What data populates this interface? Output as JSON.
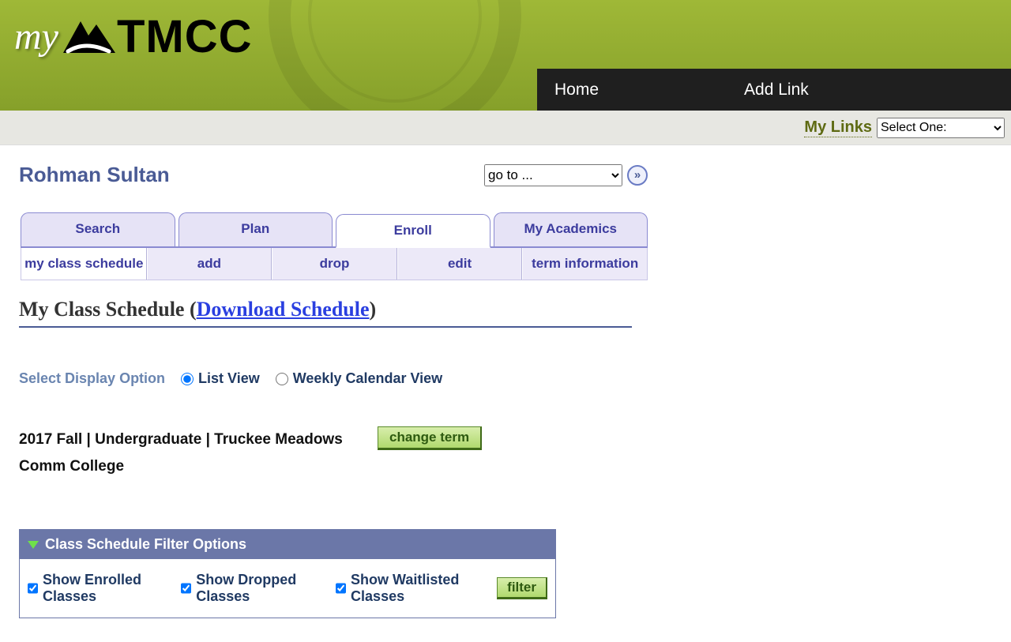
{
  "logo": {
    "my": "my",
    "tmcc": "TMCC"
  },
  "topnav": {
    "home": "Home",
    "addlink": "Add Link"
  },
  "subbar": {
    "label": "My Links",
    "select_placeholder": "Select One:"
  },
  "student": {
    "name": "Rohman Sultan"
  },
  "goto": {
    "placeholder": "go to ...",
    "go_glyph": "»"
  },
  "tabs": {
    "search": "Search",
    "plan": "Plan",
    "enroll": "Enroll",
    "academics": "My Academics"
  },
  "subtabs": {
    "schedule": "my class schedule",
    "add": "add",
    "drop": "drop",
    "edit": "edit",
    "term": "term information"
  },
  "heading": {
    "prefix": "My Class Schedule (",
    "link": "Download Schedule",
    "suffix": ")"
  },
  "display": {
    "label": "Select Display Option",
    "list": "List View",
    "weekly": "Weekly Calendar View"
  },
  "term": {
    "text": "2017 Fall | Undergraduate | Truckee Meadows Comm College",
    "change_btn": "change term"
  },
  "filter": {
    "head": "Class Schedule Filter Options",
    "enrolled": "Show Enrolled Classes",
    "dropped": "Show Dropped Classes",
    "waitlisted": "Show Waitlisted Classes",
    "btn": "filter"
  }
}
